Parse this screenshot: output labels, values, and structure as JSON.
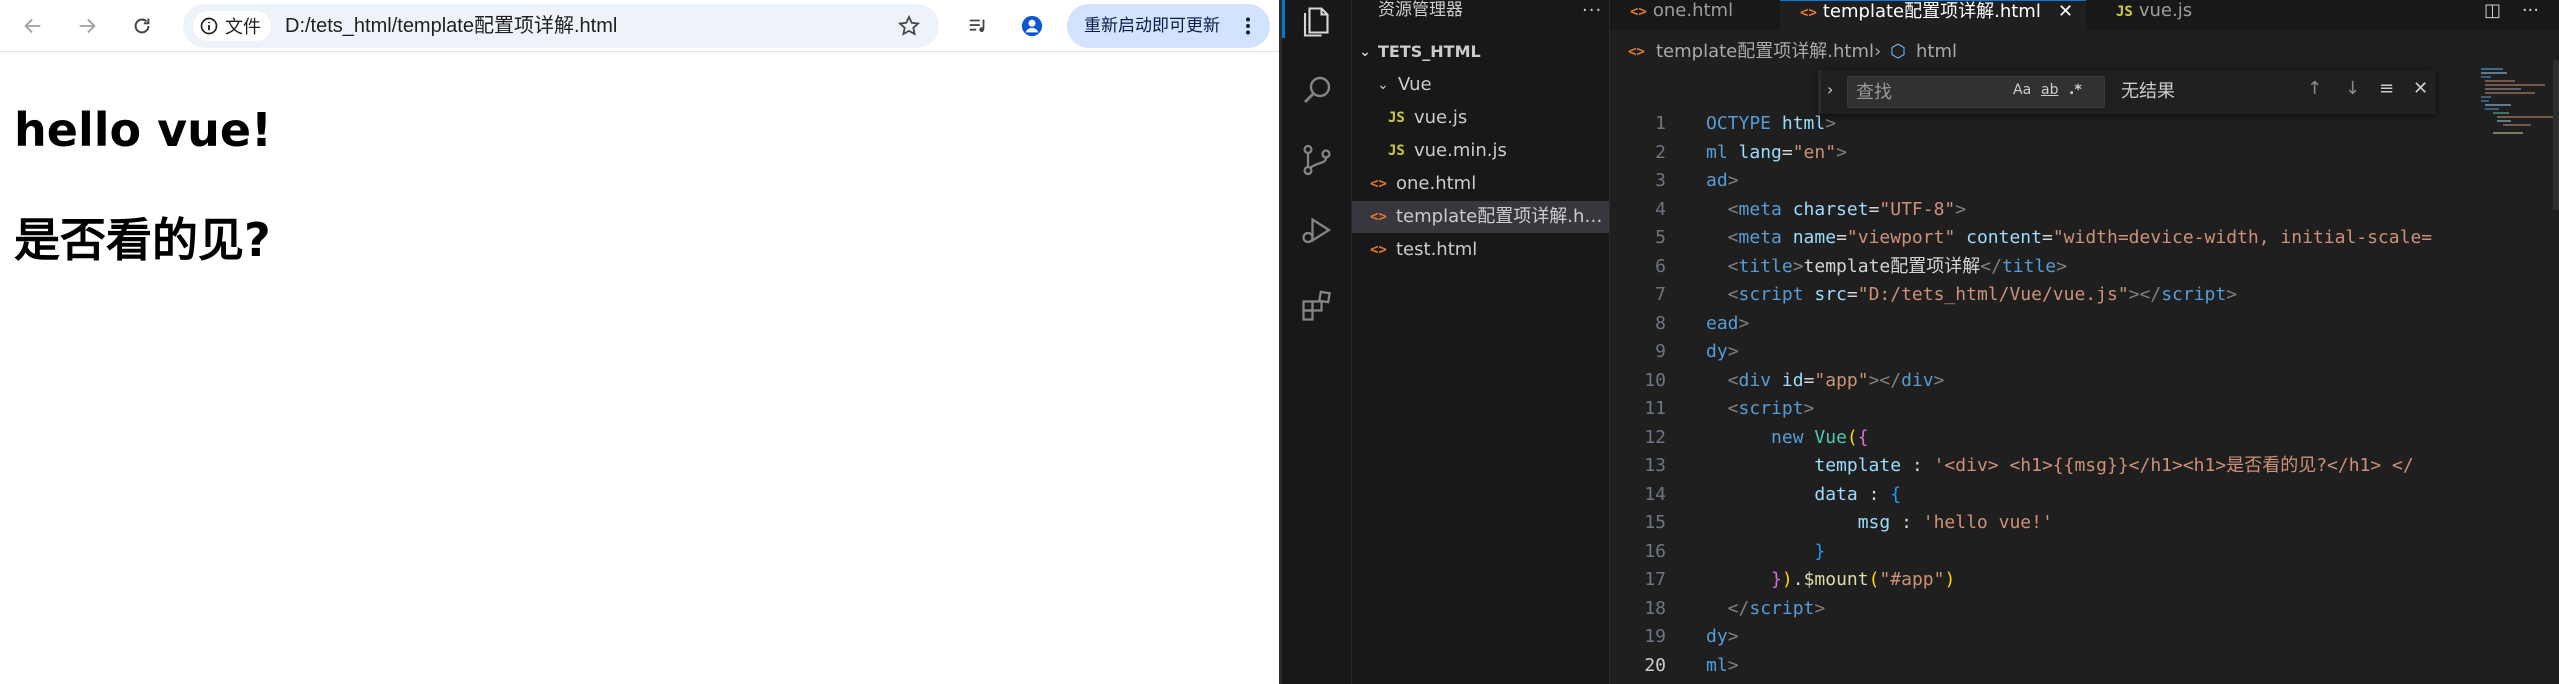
{
  "browser": {
    "site_info_label": "文件",
    "url": "D:/tets_html/template配置项详解.html",
    "update_button_label": "重新启动即可更新",
    "page": {
      "heading1": "hello vue!",
      "heading2": "是否看的见?"
    }
  },
  "vscode": {
    "sidebar": {
      "title": "资源管理器",
      "items": [
        {
          "label": "TETS_HTML",
          "kind": "root"
        },
        {
          "label": "Vue",
          "kind": "folder"
        },
        {
          "label": "vue.js",
          "kind": "js",
          "icon": "JS"
        },
        {
          "label": "vue.min.js",
          "kind": "js",
          "icon": "JS"
        },
        {
          "label": "one.html",
          "kind": "html",
          "icon": "<>"
        },
        {
          "label": "template配置项详解.html",
          "kind": "html",
          "icon": "<>"
        },
        {
          "label": "test.html",
          "kind": "html",
          "icon": "<>"
        }
      ]
    },
    "tabs": [
      {
        "label": "one.html",
        "icon": "<>"
      },
      {
        "label": "template配置项详解.html",
        "icon": "<>"
      },
      {
        "label": "vue.js",
        "icon": "JS"
      }
    ],
    "breadcrumb": {
      "file": "template配置项详解.html",
      "symbol": "html"
    },
    "find": {
      "placeholder": "查找",
      "opt_case": "Aa",
      "opt_word": "ab",
      "opt_regex": ".*",
      "result": "无结果"
    },
    "code_lines": [
      {
        "n": "1",
        "tokens": [
          [
            "tk-tag",
            "OCTYPE "
          ],
          [
            "tk-attr",
            "html"
          ],
          [
            "tk-brk",
            ">"
          ]
        ]
      },
      {
        "n": "2",
        "tokens": [
          [
            "tk-tag",
            "ml "
          ],
          [
            "tk-attr",
            "lang"
          ],
          [
            "tk-plain",
            "="
          ],
          [
            "tk-str",
            "\"en\""
          ],
          [
            "tk-brk",
            ">"
          ]
        ]
      },
      {
        "n": "3",
        "tokens": [
          [
            "tk-tag",
            "ad"
          ],
          [
            "tk-brk",
            ">"
          ]
        ]
      },
      {
        "n": "4",
        "tokens": [
          [
            "tk-brk",
            "  <"
          ],
          [
            "tk-tag",
            "meta "
          ],
          [
            "tk-attr",
            "charset"
          ],
          [
            "tk-plain",
            "="
          ],
          [
            "tk-str",
            "\"UTF-8\""
          ],
          [
            "tk-brk",
            ">"
          ]
        ]
      },
      {
        "n": "5",
        "tokens": [
          [
            "tk-brk",
            "  <"
          ],
          [
            "tk-tag",
            "meta "
          ],
          [
            "tk-attr",
            "name"
          ],
          [
            "tk-plain",
            "="
          ],
          [
            "tk-str",
            "\"viewport\" "
          ],
          [
            "tk-attr",
            "content"
          ],
          [
            "tk-plain",
            "="
          ],
          [
            "tk-str",
            "\"width=device-width, initial-scale="
          ]
        ]
      },
      {
        "n": "6",
        "tokens": [
          [
            "tk-brk",
            "  <"
          ],
          [
            "tk-tag",
            "title"
          ],
          [
            "tk-brk",
            ">"
          ],
          [
            "tk-plain",
            "template配置项详解"
          ],
          [
            "tk-brk",
            "</"
          ],
          [
            "tk-tag",
            "title"
          ],
          [
            "tk-brk",
            ">"
          ]
        ]
      },
      {
        "n": "7",
        "tokens": [
          [
            "tk-brk",
            "  <"
          ],
          [
            "tk-tag",
            "script "
          ],
          [
            "tk-attr",
            "src"
          ],
          [
            "tk-plain",
            "="
          ],
          [
            "tk-str",
            "\"D:/tets_html/Vue/vue.js\""
          ],
          [
            "tk-brk",
            "></"
          ],
          [
            "tk-tag",
            "script"
          ],
          [
            "tk-brk",
            ">"
          ]
        ]
      },
      {
        "n": "8",
        "tokens": [
          [
            "tk-tag",
            "ead"
          ],
          [
            "tk-brk",
            ">"
          ]
        ]
      },
      {
        "n": "9",
        "tokens": [
          [
            "tk-tag",
            "dy"
          ],
          [
            "tk-brk",
            ">"
          ]
        ]
      },
      {
        "n": "10",
        "tokens": [
          [
            "tk-brk",
            "  <"
          ],
          [
            "tk-tag",
            "div "
          ],
          [
            "tk-attr",
            "id"
          ],
          [
            "tk-plain",
            "="
          ],
          [
            "tk-str",
            "\"app\""
          ],
          [
            "tk-brk",
            "></"
          ],
          [
            "tk-tag",
            "div"
          ],
          [
            "tk-brk",
            ">"
          ]
        ]
      },
      {
        "n": "11",
        "tokens": [
          [
            "tk-brk",
            "  <"
          ],
          [
            "tk-tag",
            "script"
          ],
          [
            "tk-brk",
            ">"
          ]
        ]
      },
      {
        "n": "12",
        "tokens": [
          [
            "tk-plain",
            "      "
          ],
          [
            "tk-kw",
            "new "
          ],
          [
            "tk-cls",
            "Vue"
          ],
          [
            "tk-brace1",
            "("
          ],
          [
            "tk-brace2",
            "{"
          ]
        ]
      },
      {
        "n": "13",
        "tokens": [
          [
            "tk-plain",
            "          "
          ],
          [
            "tk-attr",
            "template"
          ],
          [
            "tk-plain",
            " : "
          ],
          [
            "tk-str",
            "'<div> <h1>{{msg}}</h1><h1>是否看的见?</h1> </"
          ]
        ]
      },
      {
        "n": "14",
        "tokens": [
          [
            "tk-plain",
            "          "
          ],
          [
            "tk-attr",
            "data"
          ],
          [
            "tk-plain",
            " : "
          ],
          [
            "tk-brace3",
            "{"
          ]
        ]
      },
      {
        "n": "15",
        "tokens": [
          [
            "tk-plain",
            "              "
          ],
          [
            "tk-attr",
            "msg"
          ],
          [
            "tk-plain",
            " : "
          ],
          [
            "tk-str",
            "'hello vue!'"
          ]
        ]
      },
      {
        "n": "16",
        "tokens": [
          [
            "tk-plain",
            "          "
          ],
          [
            "tk-brace3",
            "}"
          ]
        ]
      },
      {
        "n": "17",
        "tokens": [
          [
            "tk-plain",
            "      "
          ],
          [
            "tk-brace2",
            "}"
          ],
          [
            "tk-brace1",
            ")"
          ],
          [
            "tk-plain",
            "."
          ],
          [
            "tk-fn",
            "$mount"
          ],
          [
            "tk-brace1",
            "("
          ],
          [
            "tk-str",
            "\"#app\""
          ],
          [
            "tk-brace1",
            ")"
          ]
        ]
      },
      {
        "n": "18",
        "tokens": [
          [
            "tk-brk",
            "  </"
          ],
          [
            "tk-tag",
            "script"
          ],
          [
            "tk-brk",
            ">"
          ]
        ]
      },
      {
        "n": "19",
        "tokens": [
          [
            "tk-tag",
            "dy"
          ],
          [
            "tk-brk",
            ">"
          ]
        ]
      },
      {
        "n": "20",
        "tokens": [
          [
            "tk-tag",
            "ml"
          ],
          [
            "tk-brk",
            ">"
          ]
        ]
      }
    ],
    "current_line": "20"
  },
  "colors": {
    "vscode_bg": "#1f1f1f",
    "sidebar_bg": "#181818",
    "accent": "#0078d4",
    "update_btn": "#d3e3fd"
  }
}
